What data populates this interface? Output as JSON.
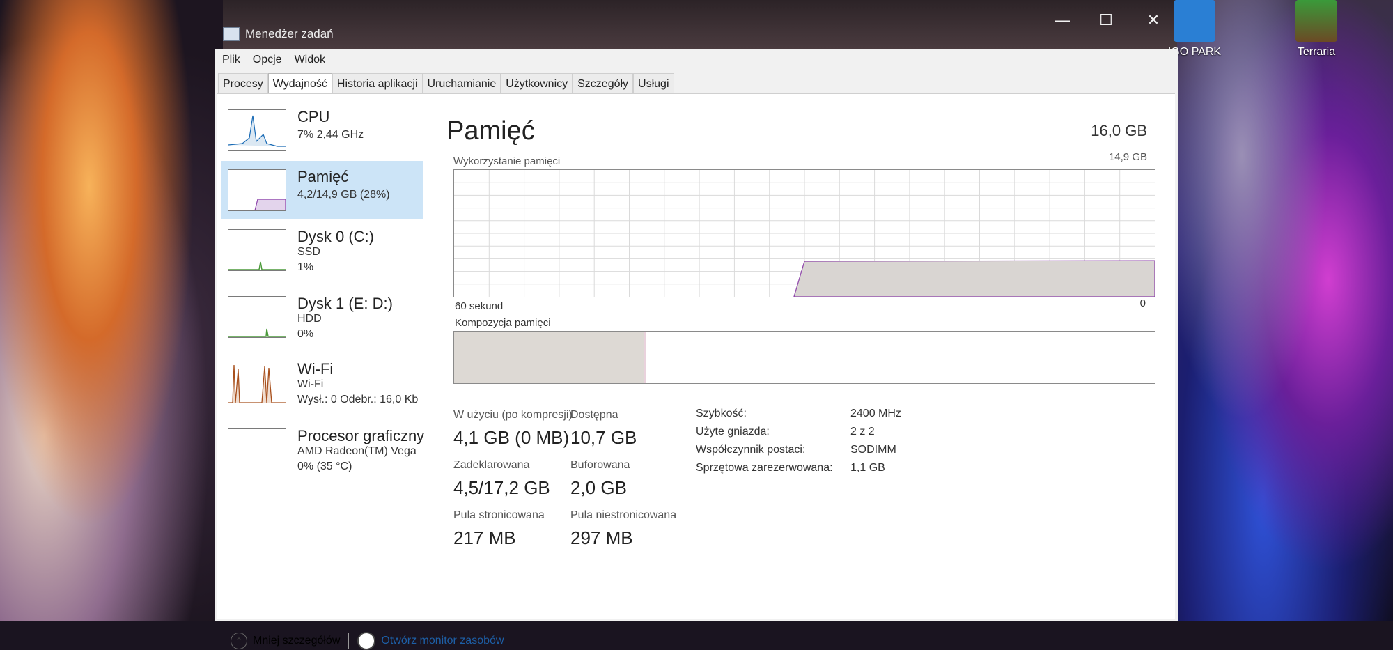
{
  "window": {
    "title": "Menedżer zadań"
  },
  "menu": [
    "Plik",
    "Opcje",
    "Widok"
  ],
  "tabs": [
    {
      "label": "Procesy"
    },
    {
      "label": "Wydajność",
      "active": true
    },
    {
      "label": "Historia aplikacji"
    },
    {
      "label": "Uruchamianie"
    },
    {
      "label": "Użytkownicy"
    },
    {
      "label": "Szczegóły"
    },
    {
      "label": "Usługi"
    }
  ],
  "sidebar": {
    "items": [
      {
        "name": "CPU",
        "sub1": "7% 2,44 GHz",
        "sub2": "",
        "selected": false
      },
      {
        "name": "Pamięć",
        "sub1": "4,2/14,9 GB (28%)",
        "sub2": "",
        "selected": true
      },
      {
        "name": "Dysk 0 (C:)",
        "sub1": "SSD",
        "sub2": "1%",
        "selected": false
      },
      {
        "name": "Dysk 1 (E: D:)",
        "sub1": "HDD",
        "sub2": "0%",
        "selected": false
      },
      {
        "name": "Wi-Fi",
        "sub1": "Wi-Fi",
        "sub2": "Wysł.: 0 Odebr.: 16,0 Kb",
        "selected": false
      },
      {
        "name": "Procesor graficzny",
        "sub1": "AMD Radeon(TM) Vega",
        "sub2": "0% (35 °C)",
        "selected": false
      }
    ]
  },
  "main": {
    "title": "Pamięć",
    "total": "16,0 GB",
    "usage_label": "Wykorzystanie pamięci",
    "usage_max": "14,9 GB",
    "axis_left": "60 sekund",
    "axis_right": "0",
    "composition_label": "Kompozycja pamięci",
    "stats": {
      "in_use_label": "W użyciu (po kompresji)",
      "in_use_value": "4,1 GB (0 MB)",
      "available_label": "Dostępna",
      "available_value": "10,7 GB",
      "committed_label": "Zadeklarowana",
      "committed_value": "4,5/17,2 GB",
      "cached_label": "Buforowana",
      "cached_value": "2,0 GB",
      "paged_label": "Pula stronicowana",
      "paged_value": "217 MB",
      "nonpaged_label": "Pula niestronicowana",
      "nonpaged_value": "297 MB"
    },
    "specs": [
      {
        "k": "Szybkość:",
        "v": "2400 MHz"
      },
      {
        "k": "Użyte gniazda:",
        "v": "2 z 2"
      },
      {
        "k": "Współczynnik postaci:",
        "v": "SODIMM"
      },
      {
        "k": "Sprzętowa zarezerwowana:",
        "v": "1,1 GB"
      }
    ]
  },
  "usage_fraction": 0.28,
  "footer": {
    "less_details": "Mniej szczegółów",
    "resource_monitor": "Otwórz monitor zasobów"
  },
  "desktop": {
    "icons": [
      {
        "label": "IGO PARK",
        "icon": "app-icon"
      },
      {
        "label": "Terraria",
        "icon": "tree-icon"
      }
    ]
  },
  "colors": {
    "accent_selected": "#cce4f7",
    "memory_line": "#8b3fa8",
    "wifi_graph": "#a8501d"
  }
}
